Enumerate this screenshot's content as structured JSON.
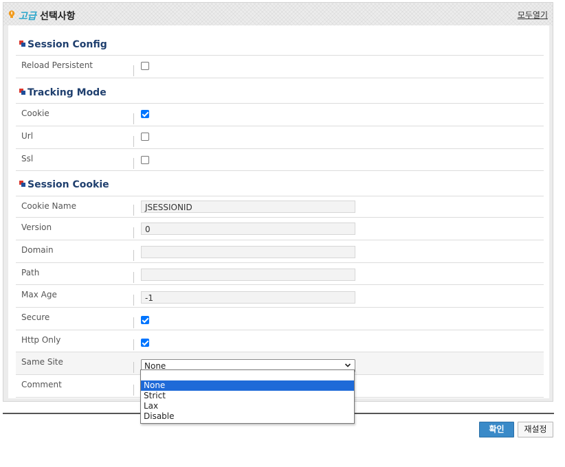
{
  "header": {
    "icon": "lightbulb-icon",
    "adv_label": "고급",
    "title": "선택사항",
    "expand_all": "모두열기"
  },
  "sections": {
    "session_config": {
      "title": "Session Config",
      "reload_persistent": {
        "label": "Reload Persistent",
        "checked": false
      }
    },
    "tracking_mode": {
      "title": "Tracking Mode",
      "cookie": {
        "label": "Cookie",
        "checked": true
      },
      "url": {
        "label": "Url",
        "checked": false
      },
      "ssl": {
        "label": "Ssl",
        "checked": false
      }
    },
    "session_cookie": {
      "title": "Session Cookie",
      "cookie_name": {
        "label": "Cookie Name",
        "value": "JSESSIONID"
      },
      "version": {
        "label": "Version",
        "value": "0"
      },
      "domain": {
        "label": "Domain",
        "value": ""
      },
      "path": {
        "label": "Path",
        "value": ""
      },
      "max_age": {
        "label": "Max Age",
        "value": "-1"
      },
      "secure": {
        "label": "Secure",
        "checked": true
      },
      "http_only": {
        "label": "Http Only",
        "checked": true
      },
      "same_site": {
        "label": "Same Site",
        "value": "None"
      },
      "comment": {
        "label": "Comment"
      }
    }
  },
  "same_site_options": [
    "None",
    "Strict",
    "Lax",
    "Disable"
  ],
  "buttons": {
    "ok": "확인",
    "reset": "재설정"
  },
  "colors": {
    "accent": "#3a8ac8",
    "section_title": "#1f3f6e",
    "selected_option": "#1e6ad8"
  }
}
